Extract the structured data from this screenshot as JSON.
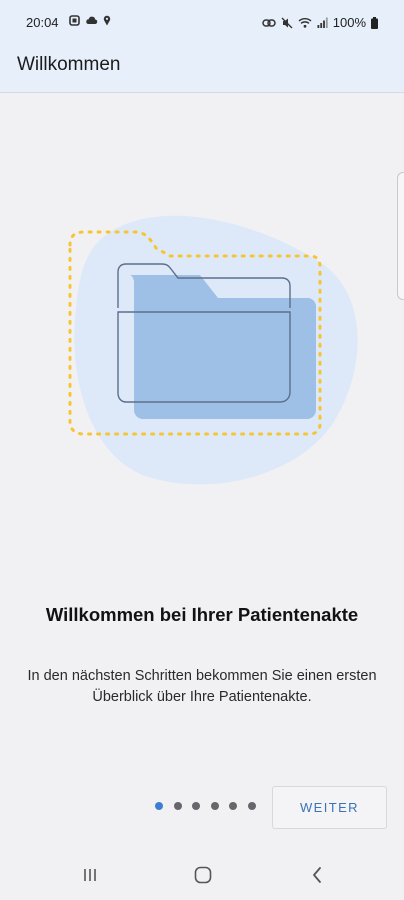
{
  "status_bar": {
    "time": "20:04",
    "battery": "100%",
    "icons": [
      "notification-icon",
      "cloud-icon",
      "location-icon",
      "link-icon",
      "mute-icon",
      "wifi-icon",
      "signal-icon",
      "battery-icon"
    ]
  },
  "app_bar": {
    "title": "Willkommen"
  },
  "illustration": {
    "icon": "folder-icon",
    "colors": {
      "blob": "#dde9f8",
      "folder_fill": "#9ec0e6",
      "dotted": "#f6c531",
      "outline": "#5b6f8c"
    }
  },
  "content": {
    "headline": "Willkommen bei Ihrer Patientenakte",
    "description": "In den nächsten Schritten bekommen Sie einen ersten Überblick über Ihre Patientenakte."
  },
  "pager": {
    "total": 6,
    "active": 1
  },
  "actions": {
    "next_label": "WEITER"
  },
  "colors": {
    "accent": "#3e7ed2",
    "app_bar": "#e7effb",
    "background": "#f1f1f4"
  },
  "nav_bar": {
    "icons": [
      "recent-apps-icon",
      "home-icon",
      "back-icon"
    ]
  }
}
